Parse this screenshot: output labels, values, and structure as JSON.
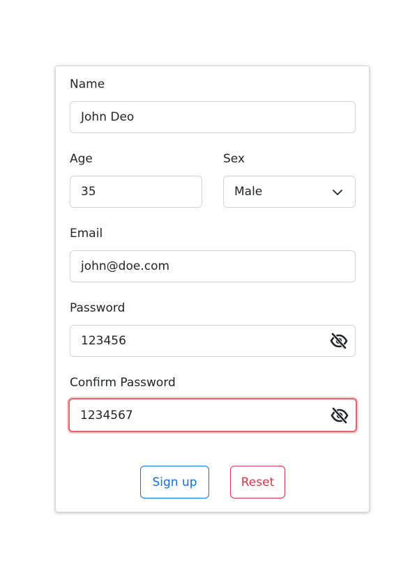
{
  "form": {
    "name": {
      "label": "Name",
      "value": "John Deo"
    },
    "age": {
      "label": "Age",
      "value": "35"
    },
    "sex": {
      "label": "Sex",
      "selected": "Male"
    },
    "email": {
      "label": "Email",
      "value": "john@doe.com"
    },
    "password": {
      "label": "Password",
      "value": "123456",
      "toggle_icon": "eye-slash-icon"
    },
    "confirm_password": {
      "label": "Confirm Password",
      "value": "1234567",
      "toggle_icon": "eye-slash-icon",
      "state": "invalid"
    }
  },
  "buttons": {
    "signup_label": "Sign up",
    "reset_label": "Reset"
  },
  "colors": {
    "primary": "#0d6efd",
    "danger": "#dc3545",
    "invalid_border": "#dc6670"
  }
}
